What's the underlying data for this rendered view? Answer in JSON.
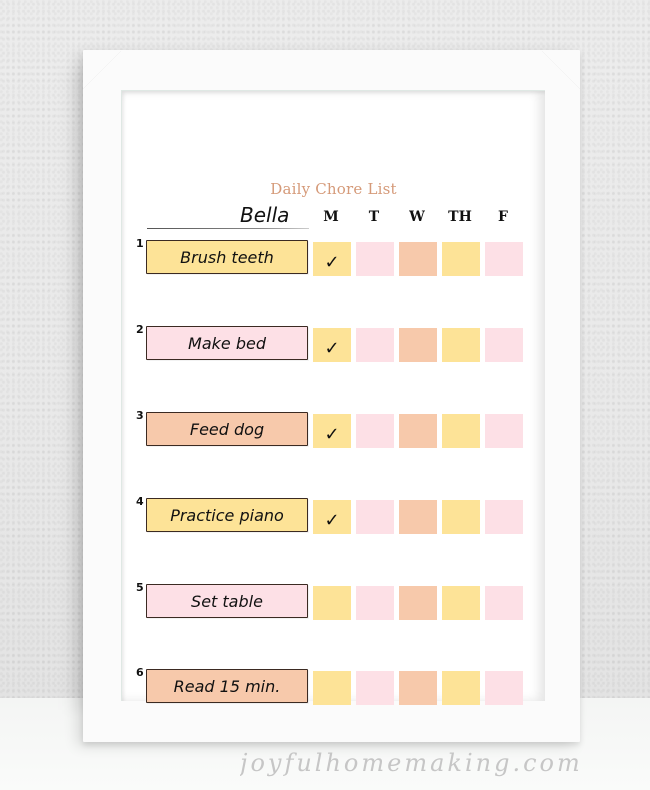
{
  "poster": {
    "title": "Daily Chore List",
    "child_name": "Bella",
    "days": [
      "M",
      "T",
      "W",
      "TH",
      "F"
    ],
    "day_colors": [
      "#fde397",
      "#fde0e6",
      "#f7c9ab",
      "#fde397",
      "#fde0e6"
    ],
    "check_icon": "✓",
    "chores": [
      {
        "number": "1",
        "label": "Brush teeth",
        "color": "#fde397",
        "checked": [
          true,
          false,
          false,
          false,
          false
        ]
      },
      {
        "number": "2",
        "label": "Make bed",
        "color": "#fde0e6",
        "checked": [
          true,
          false,
          false,
          false,
          false
        ]
      },
      {
        "number": "3",
        "label": "Feed dog",
        "color": "#f7c9ab",
        "checked": [
          true,
          false,
          false,
          false,
          false
        ]
      },
      {
        "number": "4",
        "label": "Practice piano",
        "color": "#fde397",
        "checked": [
          true,
          false,
          false,
          false,
          false
        ]
      },
      {
        "number": "5",
        "label": "Set table",
        "color": "#fde0e6",
        "checked": [
          false,
          false,
          false,
          false,
          false
        ]
      },
      {
        "number": "6",
        "label": "Read 15 min.",
        "color": "#f7c9ab",
        "checked": [
          false,
          false,
          false,
          false,
          false
        ]
      }
    ]
  },
  "watermark": "joyfulhomemaking.com"
}
